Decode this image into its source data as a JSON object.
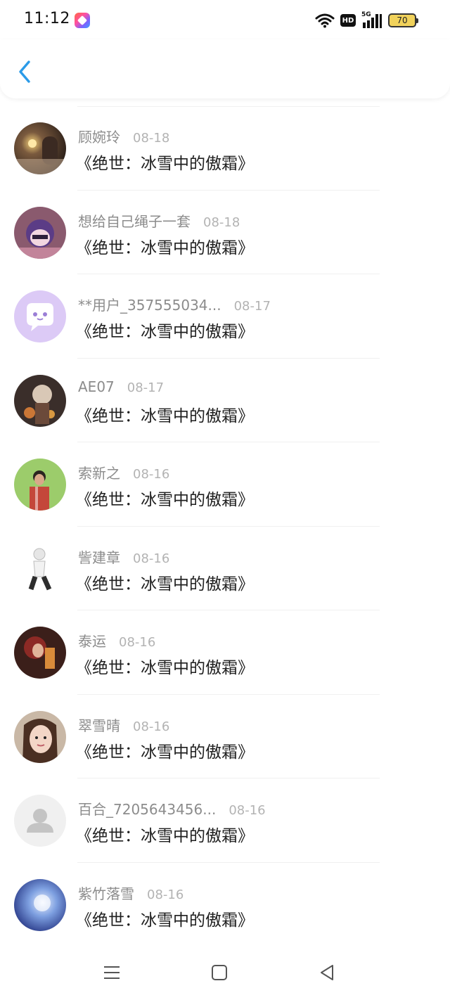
{
  "status_bar": {
    "time": "11:12",
    "network": "5G",
    "hd": "HD",
    "battery": "70",
    "icons": [
      "app-badge-icon",
      "wifi-icon",
      "hd-icon",
      "signal-icon",
      "battery-icon"
    ]
  },
  "nav": {
    "back_icon": "chevron-left-icon",
    "accent": "#2b9be8"
  },
  "items": [
    {
      "name": "顾婉玲",
      "date": "08-18",
      "title": "《绝世：冰雪中的傲霜》",
      "avatar": "photo"
    },
    {
      "name": "想给自己绳子一套",
      "date": "08-18",
      "title": "《绝世：冰雪中的傲霜》",
      "avatar": "anime"
    },
    {
      "name": "**用户_357555034...",
      "date": "08-17",
      "title": "《绝世：冰雪中的傲霜》",
      "avatar": "chat-bubble"
    },
    {
      "name": "AE07",
      "date": "08-17",
      "title": "《绝世：冰雪中的傲霜》",
      "avatar": "photo"
    },
    {
      "name": "索新之",
      "date": "08-16",
      "title": "《绝世：冰雪中的傲霜》",
      "avatar": "photo"
    },
    {
      "name": "訾建章",
      "date": "08-16",
      "title": "《绝世：冰雪中的傲霜》",
      "avatar": "sketch"
    },
    {
      "name": "泰运",
      "date": "08-16",
      "title": "《绝世：冰雪中的傲霜》",
      "avatar": "photo"
    },
    {
      "name": "翠雪晴",
      "date": "08-16",
      "title": "《绝世：冰雪中的傲霜》",
      "avatar": "photo"
    },
    {
      "name": "百合_7205643456...",
      "date": "08-16",
      "title": "《绝世：冰雪中的傲霜》",
      "avatar": "default-person"
    },
    {
      "name": "紫竹落雪",
      "date": "08-16",
      "title": "《绝世：冰雪中的傲霜》",
      "avatar": "photo"
    }
  ],
  "system_nav": {
    "icons": [
      "menu-icon",
      "home-square-icon",
      "back-triangle-icon"
    ]
  }
}
